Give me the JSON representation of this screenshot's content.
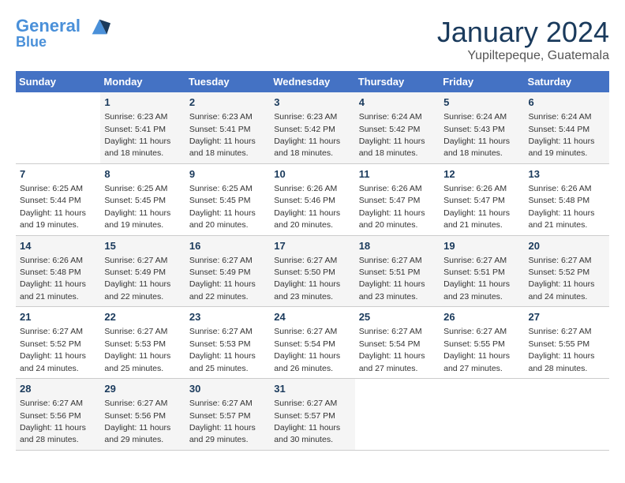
{
  "header": {
    "logo_line1": "General",
    "logo_line2": "Blue",
    "month": "January 2024",
    "location": "Yupiltepeque, Guatemala"
  },
  "weekdays": [
    "Sunday",
    "Monday",
    "Tuesday",
    "Wednesday",
    "Thursday",
    "Friday",
    "Saturday"
  ],
  "weeks": [
    [
      {
        "day": "",
        "info": ""
      },
      {
        "day": "1",
        "info": "Sunrise: 6:23 AM\nSunset: 5:41 PM\nDaylight: 11 hours and 18 minutes."
      },
      {
        "day": "2",
        "info": "Sunrise: 6:23 AM\nSunset: 5:41 PM\nDaylight: 11 hours and 18 minutes."
      },
      {
        "day": "3",
        "info": "Sunrise: 6:23 AM\nSunset: 5:42 PM\nDaylight: 11 hours and 18 minutes."
      },
      {
        "day": "4",
        "info": "Sunrise: 6:24 AM\nSunset: 5:42 PM\nDaylight: 11 hours and 18 minutes."
      },
      {
        "day": "5",
        "info": "Sunrise: 6:24 AM\nSunset: 5:43 PM\nDaylight: 11 hours and 18 minutes."
      },
      {
        "day": "6",
        "info": "Sunrise: 6:24 AM\nSunset: 5:44 PM\nDaylight: 11 hours and 19 minutes."
      }
    ],
    [
      {
        "day": "7",
        "info": "Sunrise: 6:25 AM\nSunset: 5:44 PM\nDaylight: 11 hours and 19 minutes."
      },
      {
        "day": "8",
        "info": "Sunrise: 6:25 AM\nSunset: 5:45 PM\nDaylight: 11 hours and 19 minutes."
      },
      {
        "day": "9",
        "info": "Sunrise: 6:25 AM\nSunset: 5:45 PM\nDaylight: 11 hours and 20 minutes."
      },
      {
        "day": "10",
        "info": "Sunrise: 6:26 AM\nSunset: 5:46 PM\nDaylight: 11 hours and 20 minutes."
      },
      {
        "day": "11",
        "info": "Sunrise: 6:26 AM\nSunset: 5:47 PM\nDaylight: 11 hours and 20 minutes."
      },
      {
        "day": "12",
        "info": "Sunrise: 6:26 AM\nSunset: 5:47 PM\nDaylight: 11 hours and 21 minutes."
      },
      {
        "day": "13",
        "info": "Sunrise: 6:26 AM\nSunset: 5:48 PM\nDaylight: 11 hours and 21 minutes."
      }
    ],
    [
      {
        "day": "14",
        "info": "Sunrise: 6:26 AM\nSunset: 5:48 PM\nDaylight: 11 hours and 21 minutes."
      },
      {
        "day": "15",
        "info": "Sunrise: 6:27 AM\nSunset: 5:49 PM\nDaylight: 11 hours and 22 minutes."
      },
      {
        "day": "16",
        "info": "Sunrise: 6:27 AM\nSunset: 5:49 PM\nDaylight: 11 hours and 22 minutes."
      },
      {
        "day": "17",
        "info": "Sunrise: 6:27 AM\nSunset: 5:50 PM\nDaylight: 11 hours and 23 minutes."
      },
      {
        "day": "18",
        "info": "Sunrise: 6:27 AM\nSunset: 5:51 PM\nDaylight: 11 hours and 23 minutes."
      },
      {
        "day": "19",
        "info": "Sunrise: 6:27 AM\nSunset: 5:51 PM\nDaylight: 11 hours and 23 minutes."
      },
      {
        "day": "20",
        "info": "Sunrise: 6:27 AM\nSunset: 5:52 PM\nDaylight: 11 hours and 24 minutes."
      }
    ],
    [
      {
        "day": "21",
        "info": "Sunrise: 6:27 AM\nSunset: 5:52 PM\nDaylight: 11 hours and 24 minutes."
      },
      {
        "day": "22",
        "info": "Sunrise: 6:27 AM\nSunset: 5:53 PM\nDaylight: 11 hours and 25 minutes."
      },
      {
        "day": "23",
        "info": "Sunrise: 6:27 AM\nSunset: 5:53 PM\nDaylight: 11 hours and 25 minutes."
      },
      {
        "day": "24",
        "info": "Sunrise: 6:27 AM\nSunset: 5:54 PM\nDaylight: 11 hours and 26 minutes."
      },
      {
        "day": "25",
        "info": "Sunrise: 6:27 AM\nSunset: 5:54 PM\nDaylight: 11 hours and 27 minutes."
      },
      {
        "day": "26",
        "info": "Sunrise: 6:27 AM\nSunset: 5:55 PM\nDaylight: 11 hours and 27 minutes."
      },
      {
        "day": "27",
        "info": "Sunrise: 6:27 AM\nSunset: 5:55 PM\nDaylight: 11 hours and 28 minutes."
      }
    ],
    [
      {
        "day": "28",
        "info": "Sunrise: 6:27 AM\nSunset: 5:56 PM\nDaylight: 11 hours and 28 minutes."
      },
      {
        "day": "29",
        "info": "Sunrise: 6:27 AM\nSunset: 5:56 PM\nDaylight: 11 hours and 29 minutes."
      },
      {
        "day": "30",
        "info": "Sunrise: 6:27 AM\nSunset: 5:57 PM\nDaylight: 11 hours and 29 minutes."
      },
      {
        "day": "31",
        "info": "Sunrise: 6:27 AM\nSunset: 5:57 PM\nDaylight: 11 hours and 30 minutes."
      },
      {
        "day": "",
        "info": ""
      },
      {
        "day": "",
        "info": ""
      },
      {
        "day": "",
        "info": ""
      }
    ]
  ]
}
